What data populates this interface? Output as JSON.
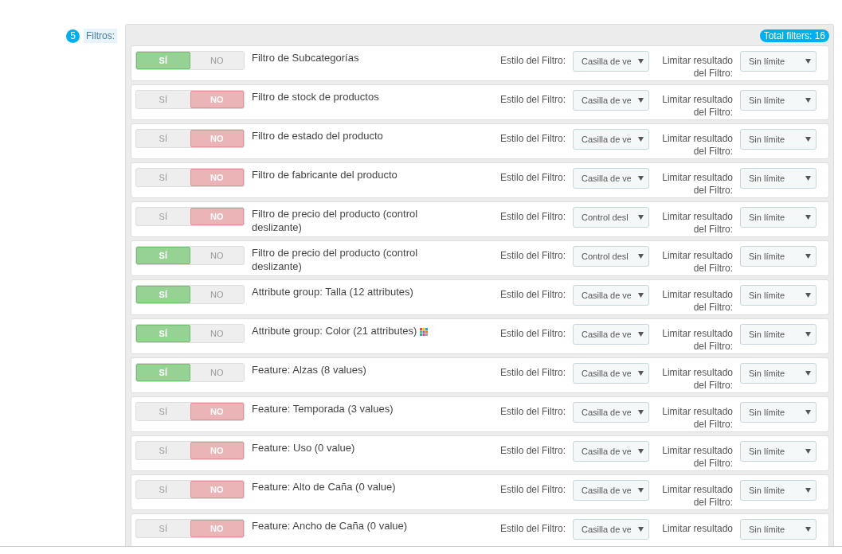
{
  "section": {
    "step": "5",
    "label": "Filtros:",
    "total": "Total filters: 16"
  },
  "filters": [
    {
      "name": "Filtro de Subcategorías",
      "enabled": true,
      "yes": "SÍ",
      "no": "NO",
      "style_label": "Estilo del Filtro:",
      "style": "Casilla de ve",
      "limit_label": "Limitar resultado del Filtro:",
      "limit": "Sin límite"
    },
    {
      "name": "Filtro de stock de productos",
      "enabled": false,
      "yes": "SÍ",
      "no": "NO",
      "style_label": "Estilo del Filtro:",
      "style": "Casilla de ve",
      "limit_label": "Limitar resultado del Filtro:",
      "limit": "Sin límite"
    },
    {
      "name": "Filtro de estado del producto",
      "enabled": false,
      "yes": "SÍ",
      "no": "NO",
      "style_label": "Estilo del Filtro:",
      "style": "Casilla de ve",
      "limit_label": "Limitar resultado del Filtro:",
      "limit": "Sin límite"
    },
    {
      "name": "Filtro de fabricante del producto",
      "enabled": false,
      "yes": "SÍ",
      "no": "NO",
      "style_label": "Estilo del Filtro:",
      "style": "Casilla de ve",
      "limit_label": "Limitar resultado del Filtro:",
      "limit": "Sin límite"
    },
    {
      "name": "Filtro de precio del producto (control deslizante)",
      "enabled": false,
      "yes": "SÍ",
      "no": "NO",
      "style_label": "Estilo del Filtro:",
      "style": "Control desl",
      "limit_label": "Limitar resultado del Filtro:",
      "limit": "Sin límite"
    },
    {
      "name": "Filtro de precio del producto (control deslizante)",
      "enabled": true,
      "yes": "SÍ",
      "no": "NO",
      "style_label": "Estilo del Filtro:",
      "style": "Control desl",
      "limit_label": "Limitar resultado del Filtro:",
      "limit": "Sin límite"
    },
    {
      "name": "Attribute group: Talla (12 attributes)",
      "enabled": true,
      "yes": "SÍ",
      "no": "NO",
      "style_label": "Estilo del Filtro:",
      "style": "Casilla de ve",
      "limit_label": "Limitar resultado del Filtro:",
      "limit": "Sin límite"
    },
    {
      "name": "Attribute group: Color (21 attributes)",
      "color_icon": true,
      "enabled": true,
      "yes": "SÍ",
      "no": "NO",
      "style_label": "Estilo del Filtro:",
      "style": "Casilla de ve",
      "limit_label": "Limitar resultado del Filtro:",
      "limit": "Sin límite"
    },
    {
      "name": "Feature: Alzas (8 values)",
      "enabled": true,
      "yes": "SÍ",
      "no": "NO",
      "style_label": "Estilo del Filtro:",
      "style": "Casilla de ve",
      "limit_label": "Limitar resultado del Filtro:",
      "limit": "Sin límite"
    },
    {
      "name": "Feature: Temporada (3 values)",
      "enabled": false,
      "yes": "SÍ",
      "no": "NO",
      "style_label": "Estilo del Filtro:",
      "style": "Casilla de ve",
      "limit_label": "Limitar resultado del Filtro:",
      "limit": "Sin límite"
    },
    {
      "name": "Feature: Uso (0 value)",
      "enabled": false,
      "yes": "SÍ",
      "no": "NO",
      "style_label": "Estilo del Filtro:",
      "style": "Casilla de ve",
      "limit_label": "Limitar resultado del Filtro:",
      "limit": "Sin límite"
    },
    {
      "name": "Feature: Alto de Caña (0 value)",
      "enabled": false,
      "yes": "SÍ",
      "no": "NO",
      "style_label": "Estilo del Filtro:",
      "style": "Casilla de ve",
      "limit_label": "Limitar resultado del Filtro:",
      "limit": "Sin límite"
    },
    {
      "name": "Feature: Ancho de Caña (0 value)",
      "enabled": false,
      "yes": "SÍ",
      "no": "NO",
      "style_label": "Estilo del Filtro:",
      "style": "Casilla de ve",
      "limit_label": "Limitar resultado",
      "limit": "Sin límite"
    }
  ]
}
